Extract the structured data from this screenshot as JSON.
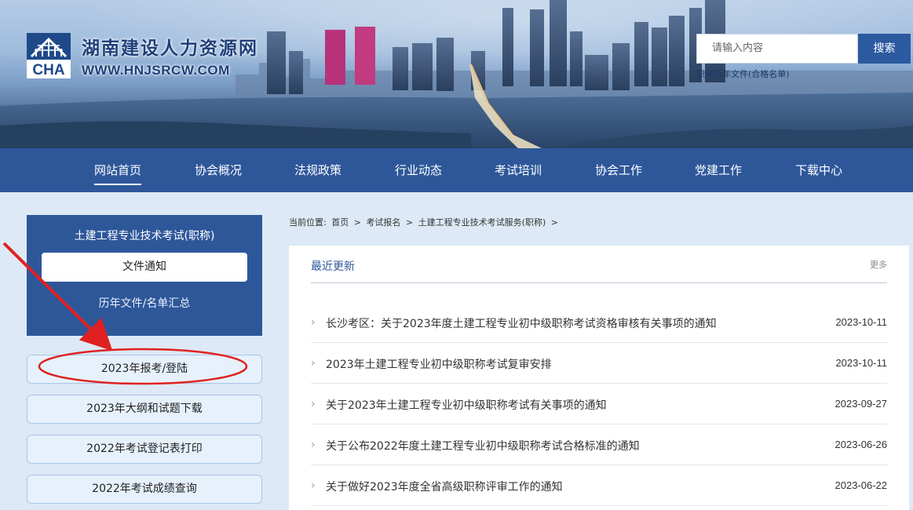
{
  "header": {
    "logo_abbr": "CHA",
    "site_name": "湖南建设人力资源网",
    "site_url": "WWW.HNJSRCW.COM",
    "search_placeholder": "请输入内容",
    "search_button": "搜索",
    "search_hint": "职称历年文件(合格名单)"
  },
  "nav": {
    "items": [
      {
        "label": "网站首页",
        "active": true
      },
      {
        "label": "协会概况"
      },
      {
        "label": "法规政策"
      },
      {
        "label": "行业动态"
      },
      {
        "label": "考试培训"
      },
      {
        "label": "协会工作"
      },
      {
        "label": "党建工作"
      },
      {
        "label": "下载中心"
      }
    ]
  },
  "sidebar": {
    "title": "土建工程专业技术考试(职称)",
    "active_item": "文件通知",
    "second_item": "历年文件/名单汇总",
    "buttons": [
      "2023年报考/登陆",
      "2023年大纲和试题下载",
      "2022年考试登记表打印",
      "2022年考试成绩查询"
    ]
  },
  "breadcrumb": {
    "prefix": "当前位置:",
    "items": [
      "首页",
      "考试报名",
      "土建工程专业技术考试服务(职称)"
    ],
    "separator": ">"
  },
  "panel": {
    "title": "最近更新",
    "more": "更多",
    "chevron": "›",
    "news": [
      {
        "title": "长沙考区：关于2023年度土建工程专业初中级职称考试资格审核有关事项的通知",
        "date": "2023-10-11"
      },
      {
        "title": "2023年土建工程专业初中级职称考试复审安排",
        "date": "2023-10-11"
      },
      {
        "title": "关于2023年土建工程专业初中级职称考试有关事项的通知",
        "date": "2023-09-27"
      },
      {
        "title": "关于公布2022年度土建工程专业初中级职称考试合格标准的通知",
        "date": "2023-06-26"
      },
      {
        "title": "关于做好2023年度全省高级职称评审工作的通知",
        "date": "2023-06-22"
      }
    ]
  },
  "colors": {
    "nav_blue": "#2e579a",
    "page_bg": "#dde9f6",
    "annotation_red": "#e02020"
  }
}
